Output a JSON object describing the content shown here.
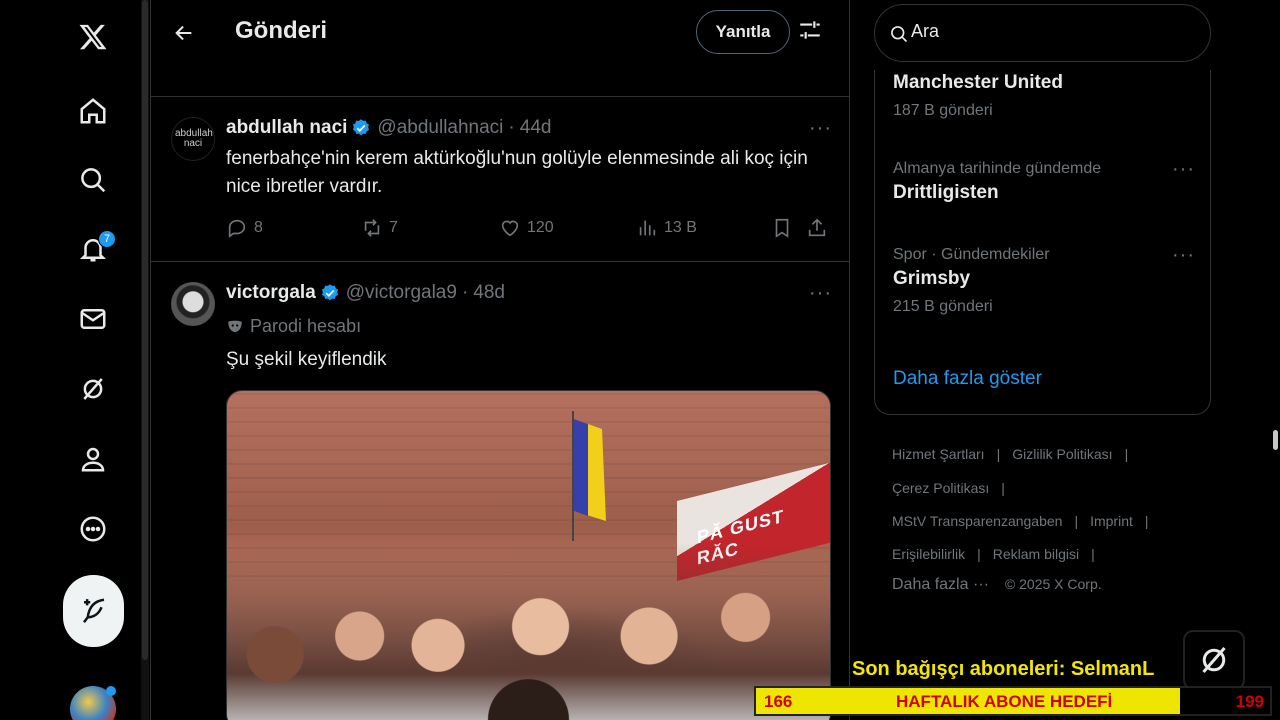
{
  "nav": {
    "notification_count": "7"
  },
  "header": {
    "title": "Gönderi",
    "reply_label": "Yanıtla"
  },
  "tweets": [
    {
      "name": "abdullah naci",
      "handle": "@abdullahnaci",
      "time": "44d",
      "text": "fenerbahçe'nin kerem aktürkoğlu'nun golüyle elenmesinde ali koç için nice ibretler vardır.",
      "avatar_text": "abdullah naci",
      "replies": "8",
      "reposts": "7",
      "likes": "120",
      "views": "13 B"
    },
    {
      "name": "victorgala",
      "handle": "@victorgala9",
      "time": "48d",
      "parody_label": "Parodi hesabı",
      "text": "Şu şekil keyiflendik",
      "media_sign_text": "PĂ GUST RĂC"
    }
  ],
  "search": {
    "placeholder": "Ara"
  },
  "trends": [
    {
      "context": "",
      "name": "Manchester United",
      "count": "187 B gönderi"
    },
    {
      "context": "Almanya tarihinde gündemde",
      "name": "Drittligisten",
      "count": ""
    },
    {
      "context": "Spor · Gündemdekiler",
      "name": "Grimsby",
      "count": "215 B gönderi"
    }
  ],
  "show_more": "Daha fazla göster",
  "footer": {
    "terms": "Hizmet Şartları",
    "privacy": "Gizlilik Politikası",
    "cookies": "Çerez Politikası",
    "transparency": "MStV Transparenzangaben",
    "imprint": "Imprint",
    "accessibility": "Erişilebilirlik",
    "ads_info": "Reklam bilgisi",
    "more": "Daha fazla ···",
    "copyright": "© 2025 X Corp."
  },
  "overlay": {
    "donor_text": "Son bağışçı aboneleri: SelmanL",
    "goal_current": "166",
    "goal_label": "HAFTALIK ABONE HEDEFİ",
    "goal_target": "199",
    "goal_progress": 0.834
  },
  "colors": {
    "accent": "#1d9bf0",
    "background": "#000000",
    "text": "#e7e9ea",
    "muted": "#71767b"
  }
}
